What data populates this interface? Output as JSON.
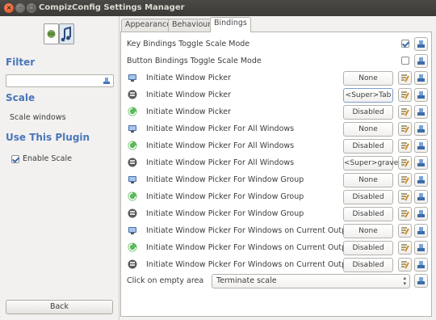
{
  "window": {
    "title": "CompizConfig Settings Manager"
  },
  "sidebar": {
    "filter_title": "Filter",
    "filter_value": "",
    "scale_title": "Scale",
    "scale_desc": "Scale windows",
    "use_title": "Use This Plugin",
    "enable_label": "Enable Scale",
    "enable_checked": true,
    "back_label": "Back"
  },
  "tabs": [
    {
      "label": "Appearance",
      "active": false
    },
    {
      "label": "Behaviour",
      "active": false
    },
    {
      "label": "Bindings",
      "active": true
    }
  ],
  "toggles": [
    {
      "label": "Key Bindings Toggle Scale Mode",
      "checked": true
    },
    {
      "label": "Button Bindings Toggle Scale Mode",
      "checked": false
    }
  ],
  "bindings": [
    {
      "type": "keyboard",
      "label": "Initiate Window Picker",
      "value": "None"
    },
    {
      "type": "mouse",
      "label": "Initiate Window Picker",
      "value": "<Super>Tab"
    },
    {
      "type": "edge",
      "label": "Initiate Window Picker",
      "value": "Disabled"
    },
    {
      "type": "keyboard",
      "label": "Initiate Window Picker For All Windows",
      "value": "None"
    },
    {
      "type": "edge",
      "label": "Initiate Window Picker For All Windows",
      "value": "Disabled"
    },
    {
      "type": "mouse",
      "label": "Initiate Window Picker For All Windows",
      "value": "<Super>grave"
    },
    {
      "type": "keyboard",
      "label": "Initiate Window Picker For Window Group",
      "value": "None"
    },
    {
      "type": "edge",
      "label": "Initiate Window Picker For Window Group",
      "value": "Disabled"
    },
    {
      "type": "mouse",
      "label": "Initiate Window Picker For Window Group",
      "value": "Disabled"
    },
    {
      "type": "keyboard",
      "label": "Initiate Window Picker For Windows on Current Output",
      "value": "None"
    },
    {
      "type": "edge",
      "label": "Initiate Window Picker For Windows on Current Output",
      "value": "Disabled"
    },
    {
      "type": "mouse",
      "label": "Initiate Window Picker For Windows on Current Output",
      "value": "Disabled"
    }
  ],
  "click_empty": {
    "label": "Click on empty area",
    "value": "Terminate scale"
  },
  "colors": {
    "accent": "#4a76b8",
    "titlebar": "#3c3b37",
    "edge_icon": "#5cb85c"
  }
}
